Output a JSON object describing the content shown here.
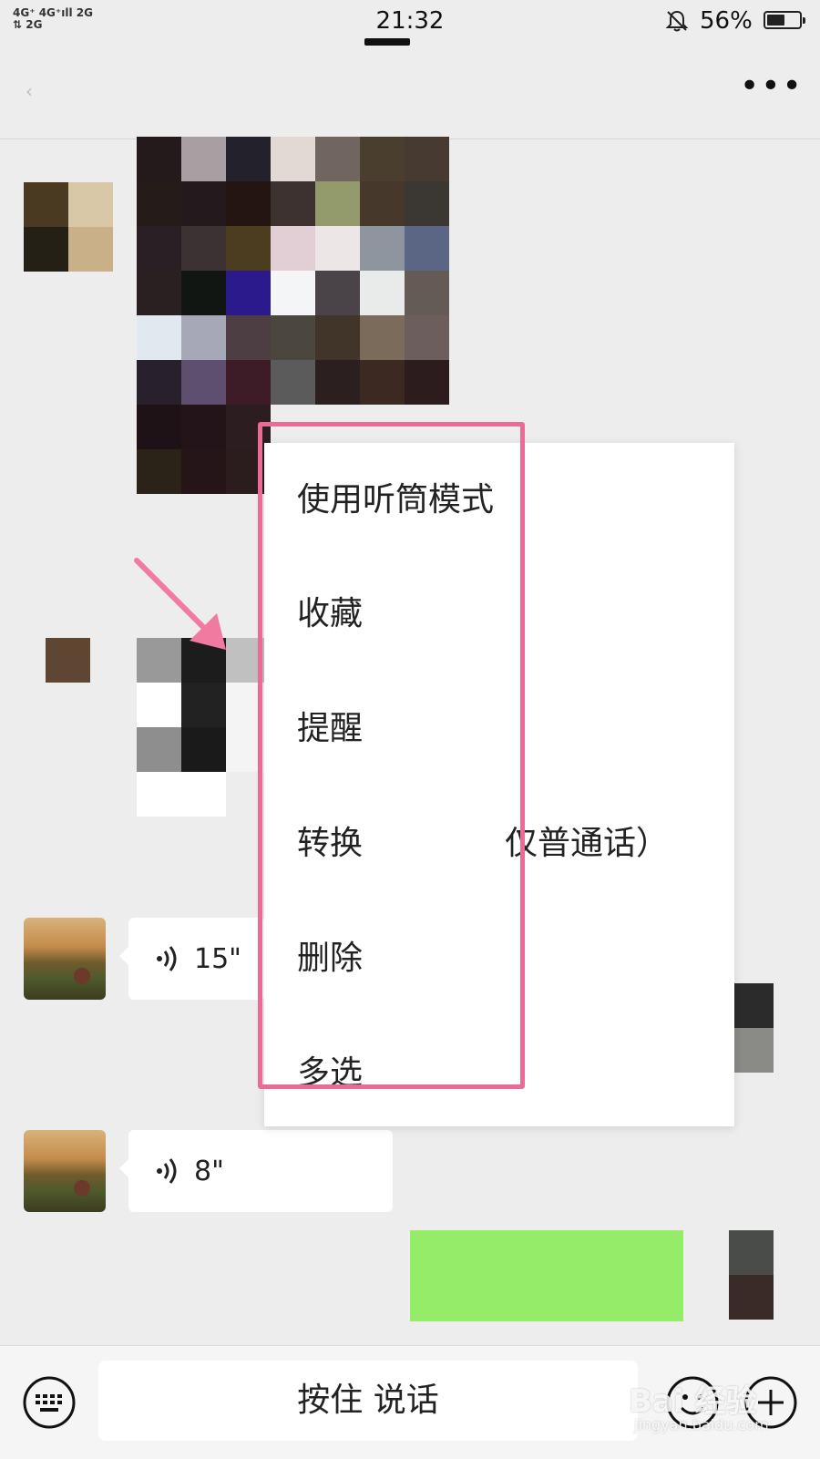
{
  "status_bar": {
    "signal_line1": "4G⁺ 4G⁺ıll 2G",
    "signal_line2": "⇅ 2G",
    "time": "21:32",
    "battery_percent": "56%",
    "battery_level": 0.56
  },
  "nav": {
    "back_icon": "chevron-left-icon",
    "more_icon": "more-dots-icon",
    "more_label": "•••"
  },
  "messages": [
    {
      "type": "voice",
      "duration": "15\""
    },
    {
      "type": "voice",
      "duration": "8\""
    }
  ],
  "context_menu": {
    "items": [
      "使用听筒模式",
      "收藏",
      "提醒",
      "转换为文字（仅普通话）",
      "删除",
      "多选"
    ],
    "visible_items": [
      "使用听筒模式",
      "收藏",
      "提醒",
      "转换",
      "仅普通话）",
      "删除",
      "多选"
    ]
  },
  "bottom_bar": {
    "talk_button_label": "按住 说话",
    "keyboard_icon": "keyboard-icon",
    "emoji_icon": "emoji-icon",
    "plus_icon": "plus-circle-icon"
  },
  "watermark": {
    "line1": "Bai 经验",
    "line2": "jingyan.baidu.com"
  },
  "colors": {
    "highlight": "#ea6b96",
    "arrow": "#f07aa0",
    "sent_bubble": "#95ec69",
    "background": "#ededed"
  }
}
